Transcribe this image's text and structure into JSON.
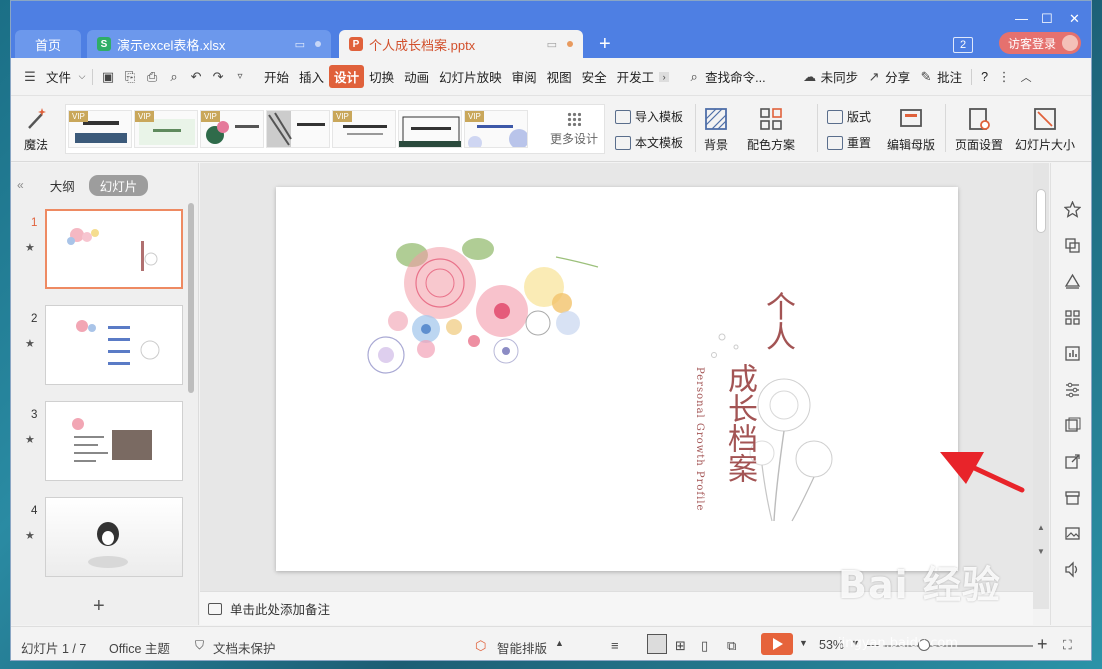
{
  "tabs": {
    "home": "首页",
    "excel": "演示excel表格.xlsx",
    "ppt": "个人成长档案.pptx",
    "excel_icon": "S",
    "ppt_icon": "P",
    "new_tab": "+"
  },
  "window": {
    "minimize": "—",
    "maximize": "☐",
    "close": "✕"
  },
  "header": {
    "badge": "2",
    "login": "访客登录"
  },
  "menu": {
    "file": "文件",
    "items": [
      "开始",
      "插入",
      "设计",
      "切换",
      "动画",
      "幻灯片放映",
      "审阅",
      "视图",
      "安全",
      "开发工"
    ],
    "active": "设计",
    "search": "查找命令...",
    "sync": "未同步",
    "share": "分享",
    "comment": "批注",
    "help": "?"
  },
  "ribbon": {
    "magic": "魔法",
    "vip": "VIP",
    "more_design": "更多设计",
    "import_template": "导入模板",
    "this_template": "本文模板",
    "background": "背景",
    "color_scheme": "配色方案",
    "layout": "版式",
    "reset": "重置",
    "edit_master": "编辑母版",
    "page_setup": "页面设置",
    "slide_size": "幻灯片大小"
  },
  "left_pane": {
    "outline": "大纲",
    "slides": "幻灯片",
    "slide_numbers": [
      "1",
      "2",
      "3",
      "4"
    ],
    "star": "★",
    "add": "+"
  },
  "slide": {
    "title_line1": "个人",
    "title_line2": "成长档案",
    "subtitle": "Personal Growth Profile"
  },
  "notes": {
    "placeholder": "单击此处添加备注"
  },
  "status": {
    "slide_count": "幻灯片 1 / 7",
    "theme": "Office 主题",
    "protect": "文档未保护",
    "smart_layout": "智能排版",
    "zoom": "53%",
    "zoom_level": 0.53,
    "minus": "—",
    "plus": "+"
  },
  "watermark": {
    "main": "Bai 经验",
    "url": "jingyan.baidu.com"
  },
  "colors": {
    "accent": "#e0613b",
    "tabbar": "#4e7fe3",
    "title_text": "#a35454"
  }
}
